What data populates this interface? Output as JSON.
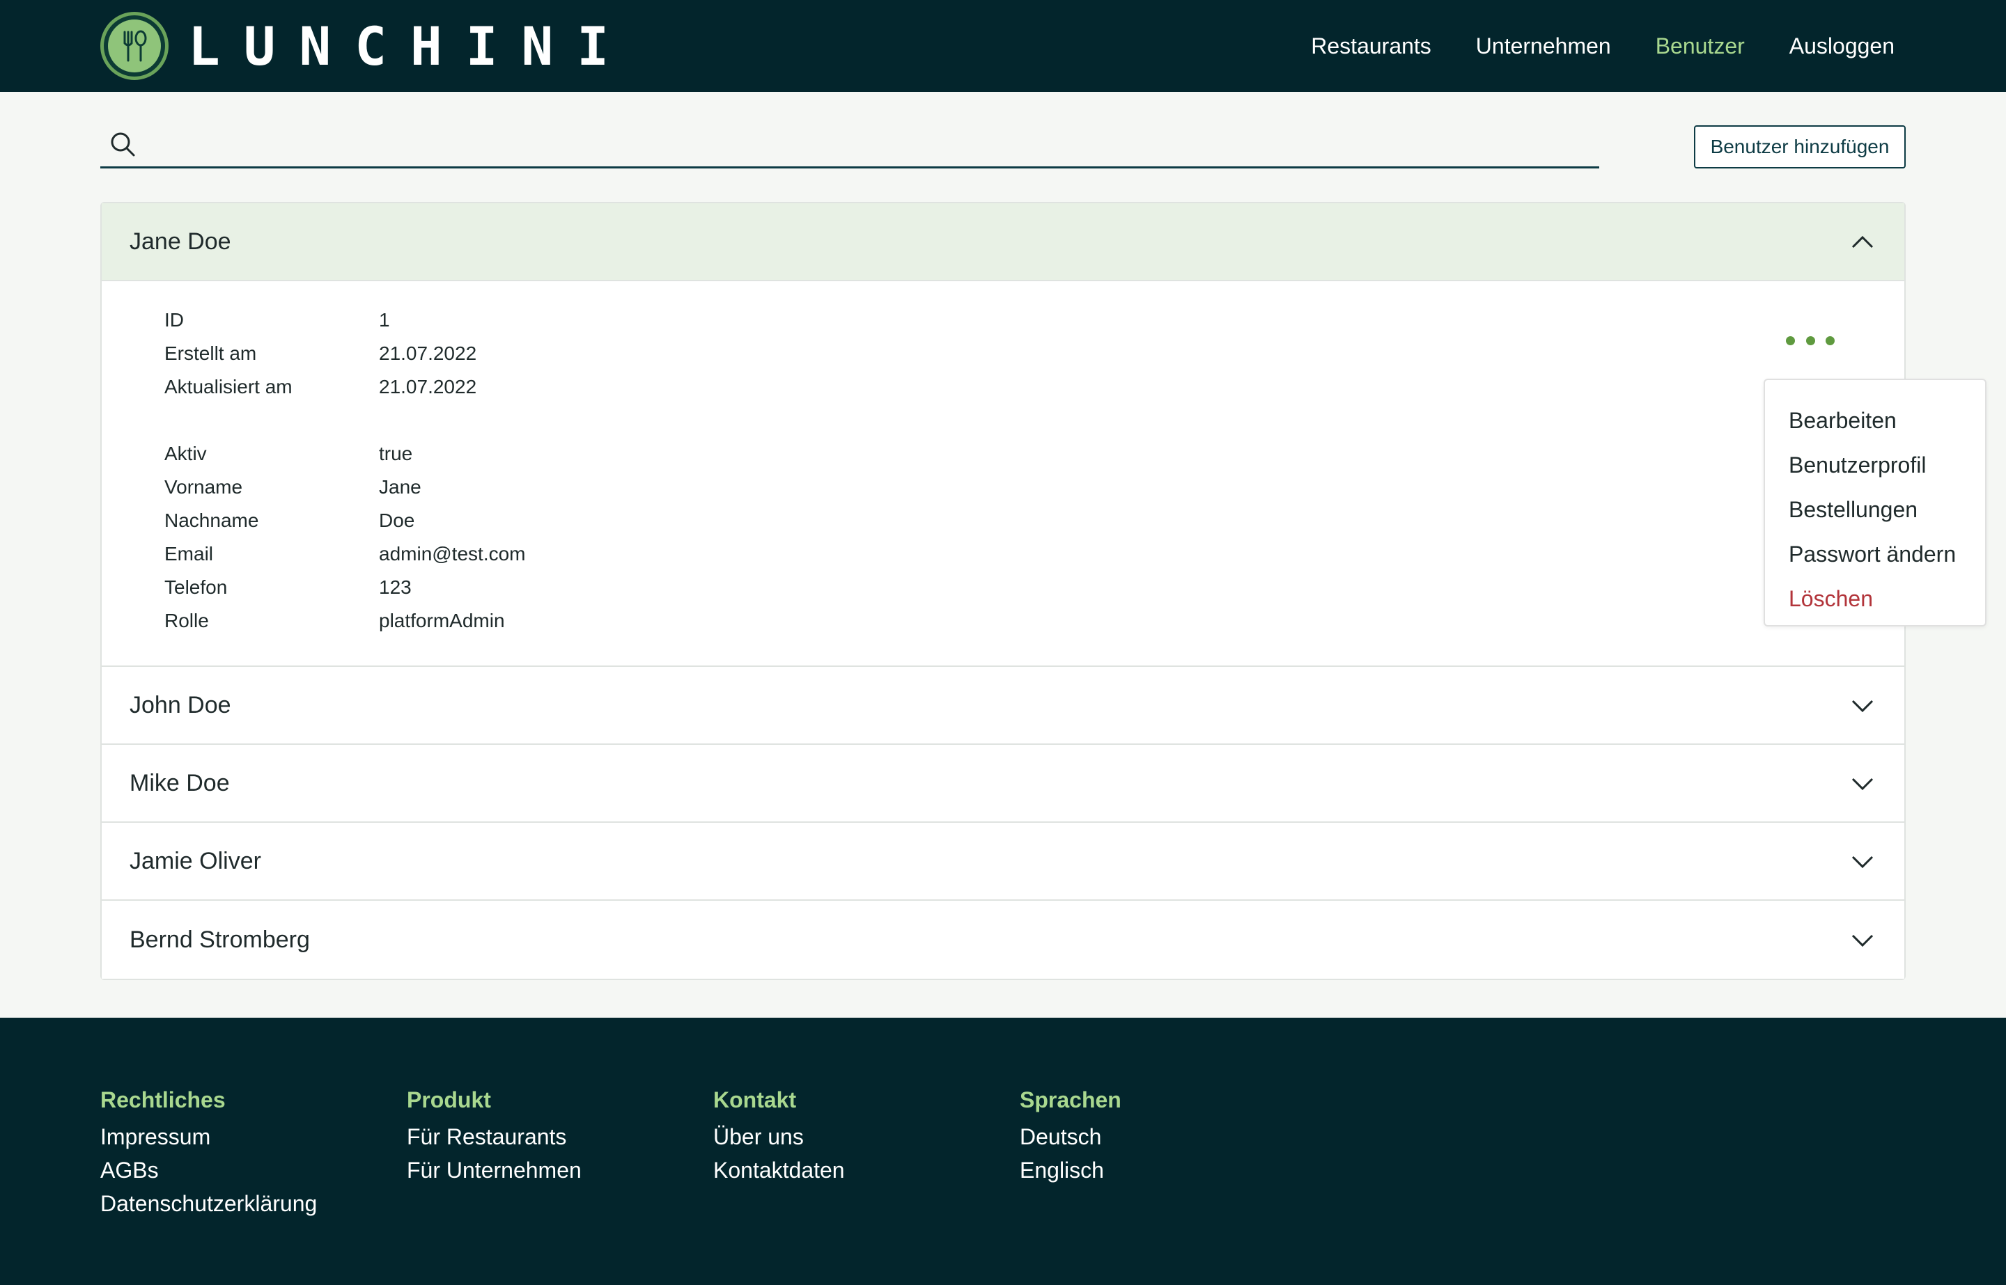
{
  "brand": {
    "name": "LUNCHINI"
  },
  "nav": {
    "items": [
      {
        "label": "Restaurants",
        "active": false
      },
      {
        "label": "Unternehmen",
        "active": false
      },
      {
        "label": "Benutzer",
        "active": true
      },
      {
        "label": "Ausloggen",
        "active": false
      }
    ]
  },
  "search": {
    "value": "",
    "placeholder": ""
  },
  "actions": {
    "add_user": "Benutzer hinzufügen"
  },
  "users": [
    {
      "name": "Jane Doe",
      "expanded": true,
      "details": {
        "id_label": "ID",
        "id": "1",
        "created_label": "Erstellt am",
        "created": "21.07.2022",
        "updated_label": "Aktualisiert am",
        "updated": "21.07.2022",
        "active_label": "Aktiv",
        "active": "true",
        "first_label": "Vorname",
        "first": "Jane",
        "last_label": "Nachname",
        "last": "Doe",
        "email_label": "Email",
        "email": "admin@test.com",
        "phone_label": "Telefon",
        "phone": "123",
        "role_label": "Rolle",
        "role": "platformAdmin"
      }
    },
    {
      "name": "John Doe",
      "expanded": false
    },
    {
      "name": "Mike Doe",
      "expanded": false
    },
    {
      "name": "Jamie Oliver",
      "expanded": false
    },
    {
      "name": "Bernd Stromberg",
      "expanded": false
    }
  ],
  "menu": {
    "items": [
      "Bearbeiten",
      "Benutzerprofil",
      "Bestellungen",
      "Passwort ändern"
    ],
    "delete": "Löschen"
  },
  "footer": {
    "legal": {
      "title": "Rechtliches",
      "links": [
        "Impressum",
        "AGBs",
        "Datenschutzerklärung"
      ]
    },
    "product": {
      "title": "Produkt",
      "links": [
        "Für Restaurants",
        "Für Unternehmen"
      ]
    },
    "contact": {
      "title": "Kontakt",
      "links": [
        "Über uns",
        "Kontaktdaten"
      ]
    },
    "languages": {
      "title": "Sprachen",
      "links": [
        "Deutsch",
        "Englisch"
      ]
    }
  },
  "colors": {
    "navbar": "#03252c",
    "accent": "#a9d88f",
    "danger": "#b2343a",
    "open_header": "#e8f1e5",
    "dots": "#5f9a3f"
  },
  "icons": [
    "logo-icon",
    "search-icon",
    "chevron-up-icon",
    "chevron-down-icon",
    "more-horizontal-icon"
  ]
}
